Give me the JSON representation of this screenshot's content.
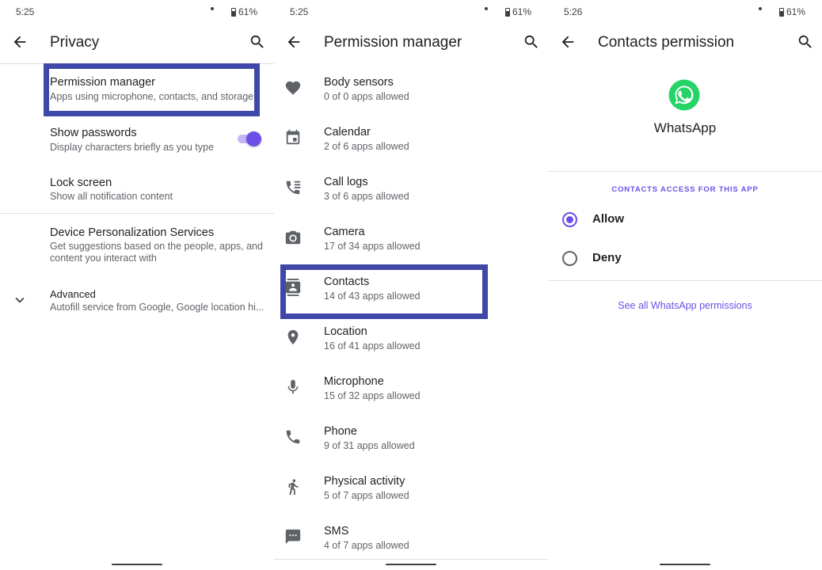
{
  "colors": {
    "accent": "#6d4fe8",
    "highlight": "#3f48a8",
    "whatsapp": "#25d366"
  },
  "panels": [
    {
      "status": {
        "time": "5:25",
        "battery": "61%"
      },
      "title": "Privacy",
      "items": [
        {
          "title": "Permission manager",
          "subtitle": "Apps using microphone, contacts, and storage"
        },
        {
          "title": "Show passwords",
          "subtitle": "Display characters briefly as you type",
          "toggle_on": true
        },
        {
          "title": "Lock screen",
          "subtitle": "Show all notification content"
        },
        {
          "title": "Device Personalization Services",
          "subtitle": "Get suggestions based on the people, apps, and",
          "subtitle2": "content you interact with"
        },
        {
          "title": "Advanced",
          "subtitle": "Autofill service from Google, Google location hi..."
        }
      ]
    },
    {
      "status": {
        "time": "5:25",
        "battery": "61%"
      },
      "title": "Permission manager",
      "items": [
        {
          "icon": "heart-icon",
          "title": "Body sensors",
          "subtitle": "0 of 0 apps allowed"
        },
        {
          "icon": "calendar-icon",
          "title": "Calendar",
          "subtitle": "2 of 6 apps allowed"
        },
        {
          "icon": "call-log-icon",
          "title": "Call logs",
          "subtitle": "3 of 6 apps allowed"
        },
        {
          "icon": "camera-icon",
          "title": "Camera",
          "subtitle": "17 of 34 apps allowed"
        },
        {
          "icon": "contacts-icon",
          "title": "Contacts",
          "subtitle": "14 of 43 apps allowed"
        },
        {
          "icon": "location-icon",
          "title": "Location",
          "subtitle": "16 of 41 apps allowed"
        },
        {
          "icon": "microphone-icon",
          "title": "Microphone",
          "subtitle": "15 of 32 apps allowed"
        },
        {
          "icon": "phone-icon",
          "title": "Phone",
          "subtitle": "9 of 31 apps allowed"
        },
        {
          "icon": "walking-icon",
          "title": "Physical activity",
          "subtitle": "5 of 7 apps allowed"
        },
        {
          "icon": "sms-icon",
          "title": "SMS",
          "subtitle": "4 of 7 apps allowed"
        }
      ]
    },
    {
      "status": {
        "time": "5:26",
        "battery": "61%"
      },
      "title": "Contacts permission",
      "app_name": "WhatsApp",
      "section_label": "CONTACTS ACCESS FOR THIS APP",
      "options": [
        {
          "label": "Allow",
          "selected": true
        },
        {
          "label": "Deny",
          "selected": false
        }
      ],
      "link": "See all WhatsApp permissions"
    }
  ]
}
